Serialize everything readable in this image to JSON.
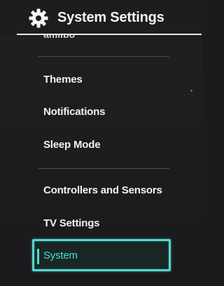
{
  "header": {
    "title": "System Settings",
    "icon": "gear-icon"
  },
  "menu": {
    "cut_off_item": "amiibo",
    "items": [
      {
        "label": "Themes"
      },
      {
        "label": "Notifications"
      },
      {
        "label": "Sleep Mode"
      },
      {
        "label": "Controllers and Sensors"
      },
      {
        "label": "TV Settings"
      },
      {
        "label": "System",
        "selected": true
      }
    ]
  },
  "colors": {
    "background": "#1d1d1f",
    "accent": "#45e0d0",
    "text": "#f2f2f2",
    "divider": "#4a4a4e"
  }
}
